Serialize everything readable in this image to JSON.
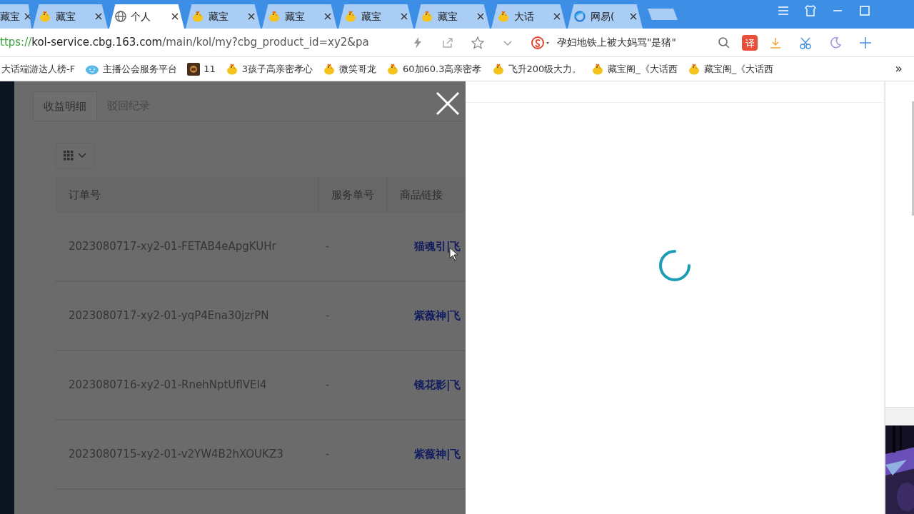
{
  "browser": {
    "tabs": [
      {
        "label": "藏宝",
        "selected": false
      },
      {
        "label": "藏宝",
        "selected": false
      },
      {
        "label": "个人",
        "selected": true
      },
      {
        "label": "藏宝",
        "selected": false
      },
      {
        "label": "藏宝",
        "selected": false
      },
      {
        "label": "藏宝",
        "selected": false
      },
      {
        "label": "藏宝",
        "selected": false
      },
      {
        "label": "大话",
        "selected": false
      },
      {
        "label": "网易(",
        "selected": false
      }
    ],
    "address": {
      "scheme": "ttps://",
      "host": "kol-service.cbg.163.com",
      "path": "/main/kol/my?cbg_product_id=xy2&pa"
    },
    "search": {
      "value": "孕妇地铁上被大妈骂\"是猪\""
    },
    "translate_button": "译",
    "bookmarks": [
      {
        "label": "大话端游达人榜-F"
      },
      {
        "label": "主播公会服务平台"
      },
      {
        "label": "11"
      },
      {
        "label": "3孩子高亲密孝心"
      },
      {
        "label": "微笑哥龙"
      },
      {
        "label": "60加60.3高亲密孝"
      },
      {
        "label": "飞升200级大力。"
      },
      {
        "label": "藏宝阁_《大话西"
      },
      {
        "label": "藏宝阁_《大话西"
      }
    ],
    "bookmarks_more": "»"
  },
  "page": {
    "tabs": [
      {
        "label": "收益明细",
        "selected": true
      },
      {
        "label": "驳回纪录",
        "selected": false
      }
    ],
    "table": {
      "columns": [
        "订单号",
        "服务单号",
        "商品链接"
      ],
      "rows": [
        {
          "order": "2023080717-xy2-01-FETAB4eApgKUHr",
          "service": "-",
          "link": "猫魂引|飞"
        },
        {
          "order": "2023080717-xy2-01-yqP4Ena30jzrPN",
          "service": "-",
          "link": "紫薇神|飞"
        },
        {
          "order": "2023080716-xy2-01-RnehNptUflVEI4",
          "service": "-",
          "link": "镜花影|飞"
        },
        {
          "order": "2023080715-xy2-01-v2YW4B2hXOUKZ3",
          "service": "-",
          "link": "紫薇神|飞"
        }
      ]
    }
  },
  "drawer": {
    "loading": true
  }
}
